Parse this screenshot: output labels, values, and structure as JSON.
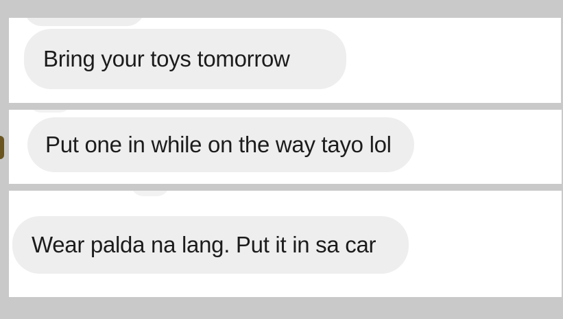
{
  "messages": [
    {
      "text": "Bring your toys tomorrow"
    },
    {
      "text": "Put one in while on the way tayo lol"
    },
    {
      "text": "Wear palda na lang. Put it in sa car"
    }
  ],
  "colors": {
    "background": "#c9c9c9",
    "panel": "#ffffff",
    "bubble": "#eeeeee",
    "text": "#1c1c1c",
    "avatar": "#6a5520"
  }
}
